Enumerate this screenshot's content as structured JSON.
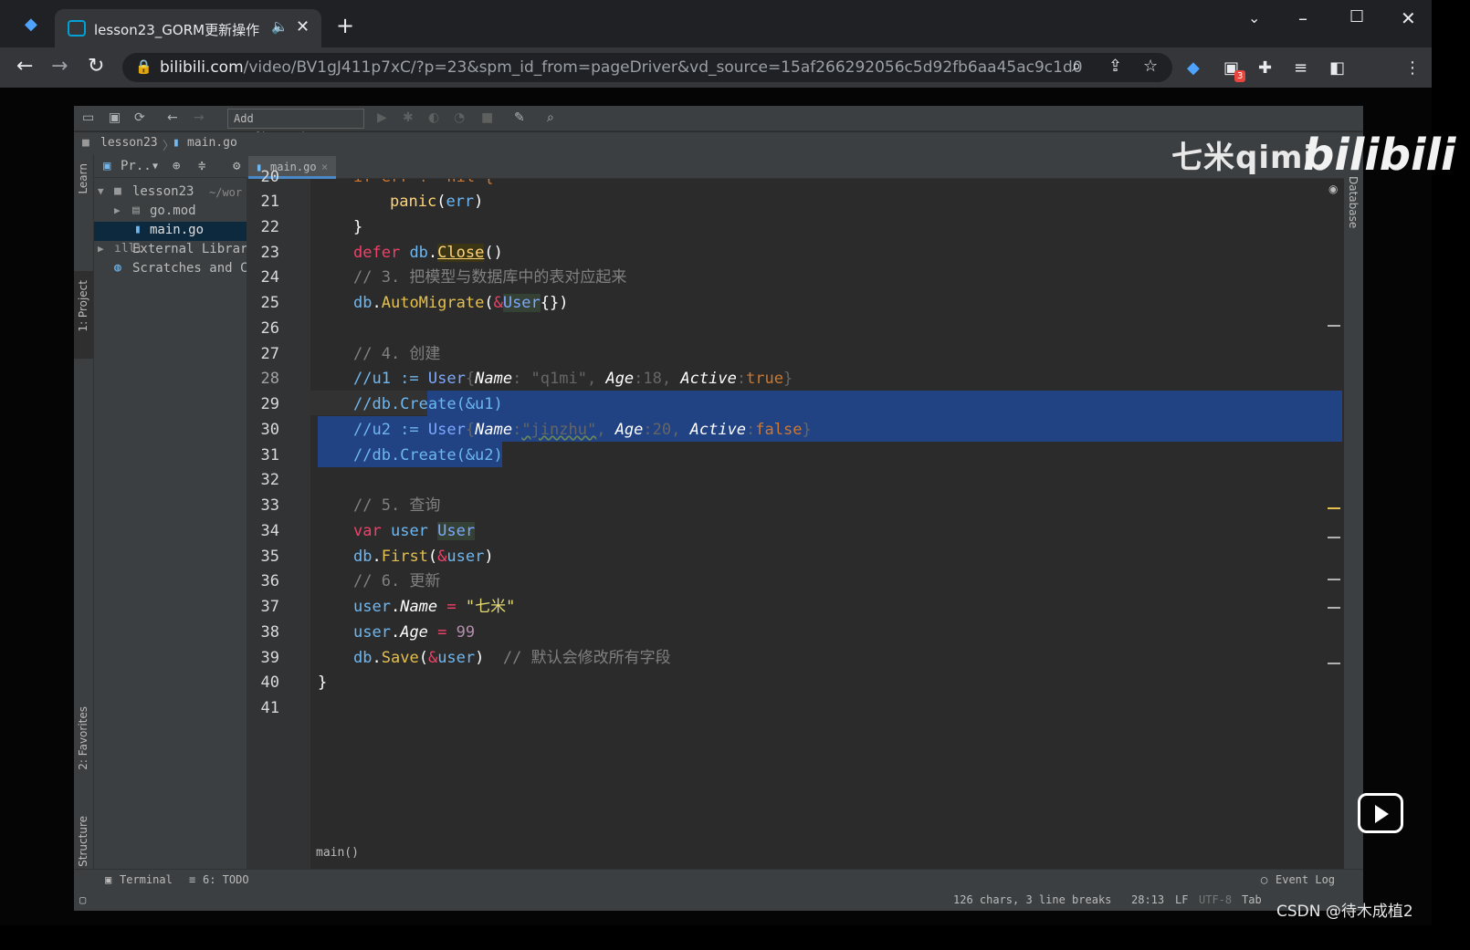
{
  "browser": {
    "tab_title": "lesson23_GORM更新操作",
    "url_host": "bilibili.com",
    "url_path": "/video/BV1gJ411p7xC/?p=23&spm_id_from=pageDriver&vd_source=15af266292056c5d92fb6aa45ac9c1d0",
    "extension_badge": "3"
  },
  "ide": {
    "add_configuration": "Add Configuration...",
    "breadcrumb_project": "lesson23",
    "breadcrumb_file": "main.go",
    "side_learn": "Learn",
    "side_project": "1: Project",
    "side_favorites": "2: Favorites",
    "side_structure": "Z: Structure",
    "side_database": "Database",
    "project_header": "Pr..",
    "tree": [
      {
        "label": "lesson23",
        "suffix": "~/wor"
      },
      {
        "label": "go.mod"
      },
      {
        "label": "main.go"
      },
      {
        "label": "External Librar"
      },
      {
        "label": "Scratches and C"
      }
    ],
    "editor_tab": "main.go",
    "line_numbers": [
      "20",
      "21",
      "22",
      "23",
      "24",
      "25",
      "26",
      "27",
      "28",
      "29",
      "30",
      "31",
      "32",
      "33",
      "34",
      "35",
      "36",
      "37",
      "38",
      "39",
      "40",
      "41"
    ],
    "code": {
      "l20": "if err != nil {",
      "l21_fn": "panic",
      "l21_arg": "err",
      "l22": "}",
      "l23_kw": "defer",
      "l23_obj": "db",
      "l23_fn": "Close",
      "l24": "// 3. 把模型与数据库中的表对应起来",
      "l25_obj": "db",
      "l25_fn": "AutoMigrate",
      "l25_type": "User",
      "l27": "// 4. 创建",
      "l28_pre": "//u1 :=",
      "l28_type": "User",
      "l28_f1": "Name",
      "l28_v1": "\"q1mi\"",
      "l28_f2": "Age",
      "l28_v2": "18",
      "l28_f3": "Active",
      "l28_v3": "true",
      "l29": "//db.Create(&u1)",
      "l30_pre": "//u2 :=",
      "l30_type": "User",
      "l30_f1": "Name",
      "l30_v1": "\"jinzhu\"",
      "l30_f2": "Age",
      "l30_v2": "20",
      "l30_f3": "Active",
      "l30_v3": "false",
      "l31": "//db.Create(&u2)",
      "l33": "// 5. 查询",
      "l34_kw": "var",
      "l34_name": "user",
      "l34_type": "User",
      "l35_obj": "db",
      "l35_fn": "First",
      "l35_arg": "user",
      "l36": "// 6. 更新",
      "l37_obj": "user",
      "l37_field": "Name",
      "l37_val": "\"七米\"",
      "l38_obj": "user",
      "l38_field": "Age",
      "l38_val": "99",
      "l39_obj": "db",
      "l39_fn": "Save",
      "l39_arg": "user",
      "l39_comment": "// 默认会修改所有字段",
      "l40": "}"
    },
    "breadcrumb_function": "main()",
    "bottom_terminal": "Terminal",
    "bottom_todo": "6: TODO",
    "event_log": "Event Log",
    "status": {
      "selection": "126 chars, 3 line breaks",
      "position": "28:13",
      "line_sep": "LF",
      "encoding": "UTF-8",
      "indent": "Tab"
    }
  },
  "overlays": {
    "watermark_text": "七米qimi",
    "watermark_logo": "bilibili",
    "csdn": "CSDN @待木成植2"
  },
  "colors": {
    "ide_bg": "#2b2b2b",
    "keyword": "#f0416a",
    "identifier": "#6eb7f1",
    "comment": "#808080",
    "string": "#e6db74",
    "number": "#b48ead",
    "selection": "#214283"
  }
}
